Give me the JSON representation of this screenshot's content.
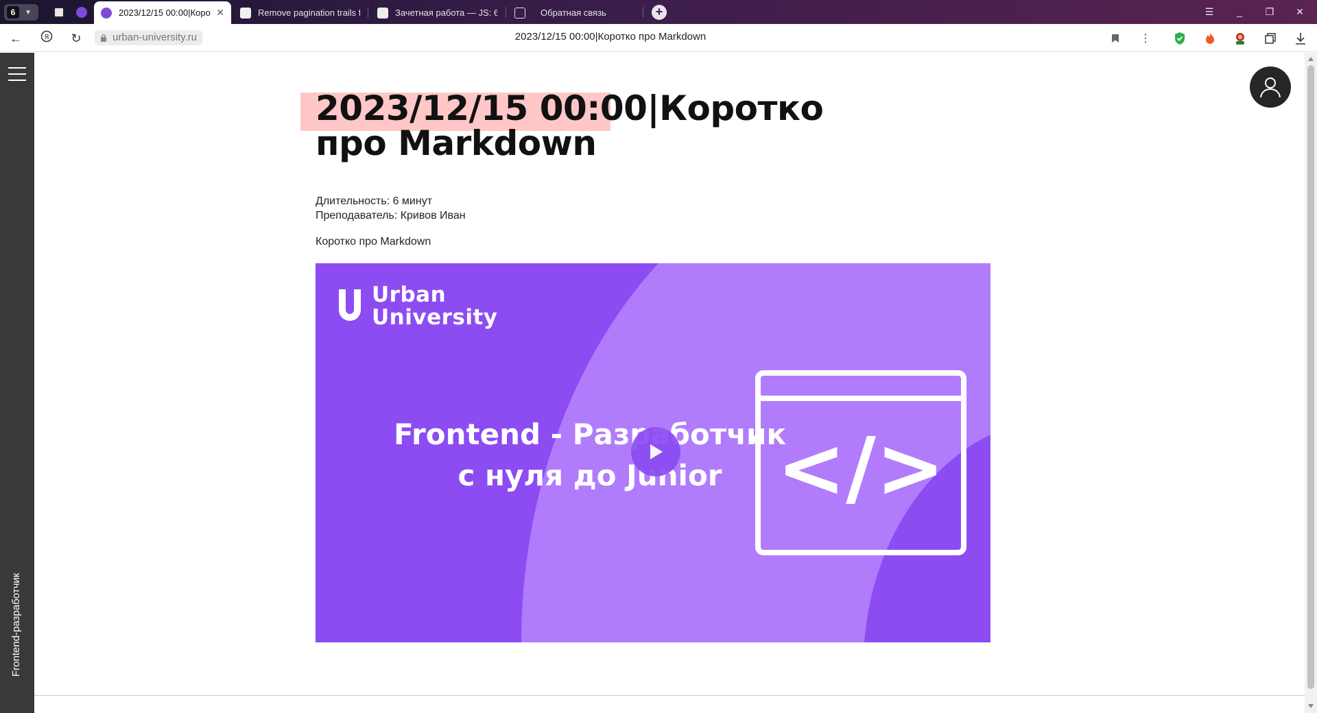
{
  "browser": {
    "tab_count": "6",
    "tabs": [
      {
        "label": "2023/12/15 00:00|Коро",
        "active": true
      },
      {
        "label": "Remove pagination trails fr",
        "active": false
      },
      {
        "label": "Зачетная работа — JS: 6а",
        "active": false
      },
      {
        "label": "Обратная связь",
        "active": false
      }
    ],
    "url": "urban-university.ru",
    "page_title": "2023/12/15 00:00|Коротко про Markdown"
  },
  "rail": {
    "label": "Frontend-разработчик"
  },
  "lesson": {
    "title_date": "2023/12/15 00:00|",
    "title_line1_rest": "Коротко",
    "title_line2": "про Markdown",
    "duration": "Длительность: 6 минут",
    "teacher": "Преподаватель: Кривов Иван",
    "description": "Коротко про Markdown"
  },
  "video": {
    "logo_line1": "Urban",
    "logo_line2": "University",
    "headline_line1": "Frontend - Разработчик",
    "headline_line2": "с нуля до Junior",
    "code_glyph": "</>"
  },
  "colors": {
    "video_purple": "#8c4cf2",
    "video_light": "#b07cfb",
    "title_highlight": "#ffc7c7",
    "rail": "#393939"
  }
}
